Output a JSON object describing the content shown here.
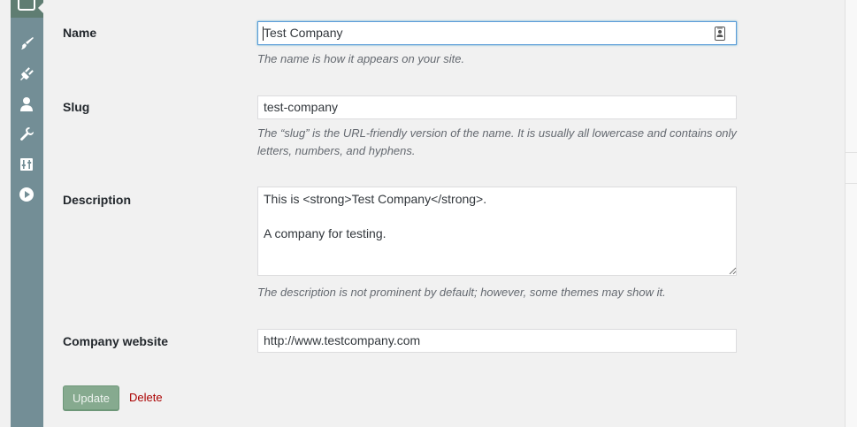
{
  "form": {
    "name": {
      "label": "Name",
      "value": "Test Company",
      "help": "The name is how it appears on your site."
    },
    "slug": {
      "label": "Slug",
      "value": "test-company",
      "help_line1": "The “slug” is the URL-friendly version of the name. It is usually all lowercase and contains only",
      "help_line2": "letters, numbers, and hyphens."
    },
    "description": {
      "label": "Description",
      "value": "This is <strong>Test Company</strong>.\n\nA company for testing.",
      "help": "The description is not prominent by default; however, some themes may show it."
    },
    "website": {
      "label": "Company website",
      "value": "http://www.testcompany.com"
    },
    "actions": {
      "update_label": "Update",
      "delete_label": "Delete"
    }
  },
  "sidebar": {
    "icons": [
      "portfolio-icon",
      "appearance-brush-icon",
      "plugins-icon",
      "users-icon",
      "tools-wrench-icon",
      "settings-sliders-icon",
      "media-play-icon"
    ]
  },
  "colors": {
    "sidebar": "#738e96",
    "button_primary": "#86aa8f",
    "delete_link": "#aa0000",
    "focus_border": "#5b9dd9"
  }
}
